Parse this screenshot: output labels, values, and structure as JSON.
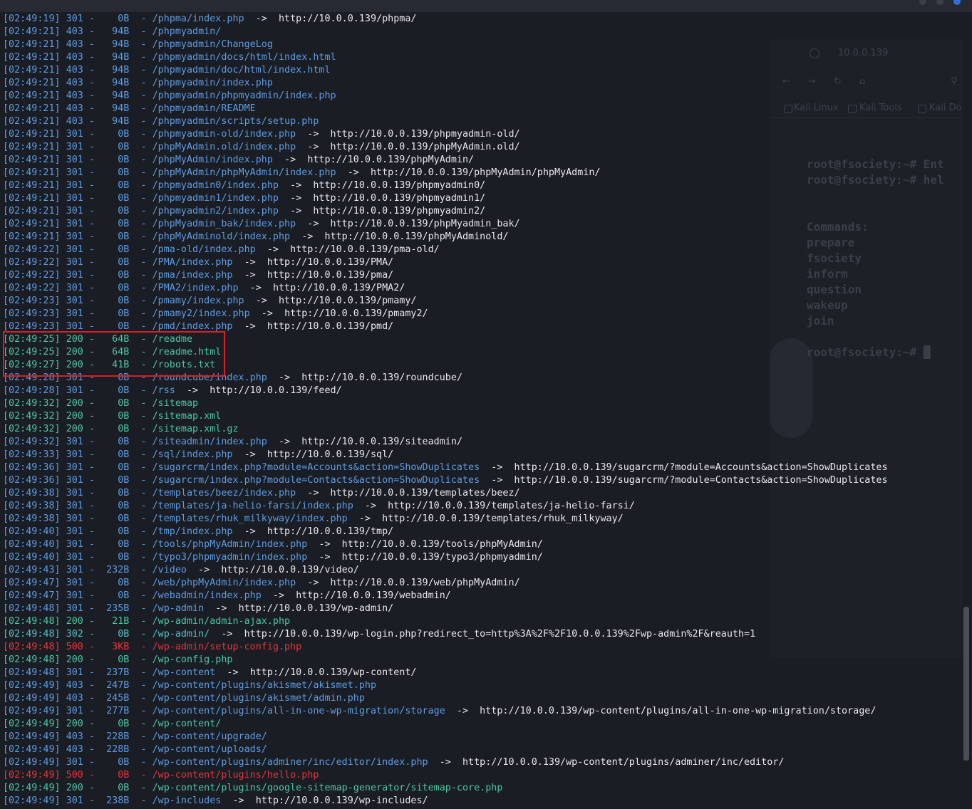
{
  "colors": {
    "status_200": "#4cc7a0",
    "status_301": "#5c9ce3",
    "status_302": "#54c1c8",
    "status_403": "#5c9ce3",
    "status_500": "#e5353d",
    "text": "#e6e8ec",
    "highlight_box": "#d61f26"
  },
  "background_window": {
    "tab_title": "10.0.0.139",
    "bookmarks": [
      "Kali Linux",
      "Kali Tools",
      "Kali Do"
    ],
    "terminal_lines": [
      "root@fsociety:~# Ent",
      "root@fsociety:~# hel",
      "",
      "",
      "Commands:",
      "prepare",
      "fsociety",
      "inform",
      "question",
      "wakeup",
      "join",
      "",
      "root@fsociety:~# █"
    ]
  },
  "scan_results": [
    {
      "time": "[02:49:19]",
      "status": "301",
      "size": "0B",
      "path": "/phpma/index.php",
      "redirect": "http://10.0.0.139/phpma/"
    },
    {
      "time": "[02:49:21]",
      "status": "403",
      "size": "94B",
      "path": "/phpmyadmin/",
      "redirect": ""
    },
    {
      "time": "[02:49:21]",
      "status": "403",
      "size": "94B",
      "path": "/phpmyadmin/ChangeLog",
      "redirect": ""
    },
    {
      "time": "[02:49:21]",
      "status": "403",
      "size": "94B",
      "path": "/phpmyadmin/docs/html/index.html",
      "redirect": ""
    },
    {
      "time": "[02:49:21]",
      "status": "403",
      "size": "94B",
      "path": "/phpmyadmin/doc/html/index.html",
      "redirect": ""
    },
    {
      "time": "[02:49:21]",
      "status": "403",
      "size": "94B",
      "path": "/phpmyadmin/index.php",
      "redirect": ""
    },
    {
      "time": "[02:49:21]",
      "status": "403",
      "size": "94B",
      "path": "/phpmyadmin/phpmyadmin/index.php",
      "redirect": ""
    },
    {
      "time": "[02:49:21]",
      "status": "403",
      "size": "94B",
      "path": "/phpmyadmin/README",
      "redirect": ""
    },
    {
      "time": "[02:49:21]",
      "status": "403",
      "size": "94B",
      "path": "/phpmyadmin/scripts/setup.php",
      "redirect": ""
    },
    {
      "time": "[02:49:21]",
      "status": "301",
      "size": "0B",
      "path": "/phpmyadmin-old/index.php",
      "redirect": "http://10.0.0.139/phpmyadmin-old/"
    },
    {
      "time": "[02:49:21]",
      "status": "301",
      "size": "0B",
      "path": "/phpMyAdmin.old/index.php",
      "redirect": "http://10.0.0.139/phpMyAdmin.old/"
    },
    {
      "time": "[02:49:21]",
      "status": "301",
      "size": "0B",
      "path": "/phpMyAdmin/index.php",
      "redirect": "http://10.0.0.139/phpMyAdmin/"
    },
    {
      "time": "[02:49:21]",
      "status": "301",
      "size": "0B",
      "path": "/phpMyAdmin/phpMyAdmin/index.php",
      "redirect": "http://10.0.0.139/phpMyAdmin/phpMyAdmin/"
    },
    {
      "time": "[02:49:21]",
      "status": "301",
      "size": "0B",
      "path": "/phpmyadmin0/index.php",
      "redirect": "http://10.0.0.139/phpmyadmin0/"
    },
    {
      "time": "[02:49:21]",
      "status": "301",
      "size": "0B",
      "path": "/phpmyadmin1/index.php",
      "redirect": "http://10.0.0.139/phpmyadmin1/"
    },
    {
      "time": "[02:49:21]",
      "status": "301",
      "size": "0B",
      "path": "/phpmyadmin2/index.php",
      "redirect": "http://10.0.0.139/phpmyadmin2/"
    },
    {
      "time": "[02:49:21]",
      "status": "301",
      "size": "0B",
      "path": "/phpMyadmin_bak/index.php",
      "redirect": "http://10.0.0.139/phpMyadmin_bak/"
    },
    {
      "time": "[02:49:21]",
      "status": "301",
      "size": "0B",
      "path": "/phpMyAdminold/index.php",
      "redirect": "http://10.0.0.139/phpMyAdminold/"
    },
    {
      "time": "[02:49:22]",
      "status": "301",
      "size": "0B",
      "path": "/pma-old/index.php",
      "redirect": "http://10.0.0.139/pma-old/"
    },
    {
      "time": "[02:49:22]",
      "status": "301",
      "size": "0B",
      "path": "/PMA/index.php",
      "redirect": "http://10.0.0.139/PMA/"
    },
    {
      "time": "[02:49:22]",
      "status": "301",
      "size": "0B",
      "path": "/pma/index.php",
      "redirect": "http://10.0.0.139/pma/"
    },
    {
      "time": "[02:49:22]",
      "status": "301",
      "size": "0B",
      "path": "/PMA2/index.php",
      "redirect": "http://10.0.0.139/PMA2/"
    },
    {
      "time": "[02:49:23]",
      "status": "301",
      "size": "0B",
      "path": "/pmamy/index.php",
      "redirect": "http://10.0.0.139/pmamy/"
    },
    {
      "time": "[02:49:23]",
      "status": "301",
      "size": "0B",
      "path": "/pmamy2/index.php",
      "redirect": "http://10.0.0.139/pmamy2/"
    },
    {
      "time": "[02:49:23]",
      "status": "301",
      "size": "0B",
      "path": "/pmd/index.php",
      "redirect": "http://10.0.0.139/pmd/"
    },
    {
      "time": "[02:49:25]",
      "status": "200",
      "size": "64B",
      "path": "/readme",
      "redirect": ""
    },
    {
      "time": "[02:49:25]",
      "status": "200",
      "size": "64B",
      "path": "/readme.html",
      "redirect": ""
    },
    {
      "time": "[02:49:27]",
      "status": "200",
      "size": "41B",
      "path": "/robots.txt",
      "redirect": ""
    },
    {
      "time": "[02:49:28]",
      "status": "301",
      "size": "0B",
      "path": "/roundcube/index.php",
      "redirect": "http://10.0.0.139/roundcube/"
    },
    {
      "time": "[02:49:28]",
      "status": "301",
      "size": "0B",
      "path": "/rss",
      "redirect": "http://10.0.0.139/feed/"
    },
    {
      "time": "[02:49:32]",
      "status": "200",
      "size": "0B",
      "path": "/sitemap",
      "redirect": ""
    },
    {
      "time": "[02:49:32]",
      "status": "200",
      "size": "0B",
      "path": "/sitemap.xml",
      "redirect": ""
    },
    {
      "time": "[02:49:32]",
      "status": "200",
      "size": "0B",
      "path": "/sitemap.xml.gz",
      "redirect": ""
    },
    {
      "time": "[02:49:32]",
      "status": "301",
      "size": "0B",
      "path": "/siteadmin/index.php",
      "redirect": "http://10.0.0.139/siteadmin/"
    },
    {
      "time": "[02:49:33]",
      "status": "301",
      "size": "0B",
      "path": "/sql/index.php",
      "redirect": "http://10.0.0.139/sql/"
    },
    {
      "time": "[02:49:36]",
      "status": "301",
      "size": "0B",
      "path": "/sugarcrm/index.php?module=Accounts&action=ShowDuplicates",
      "redirect": "http://10.0.0.139/sugarcrm/?module=Accounts&action=ShowDuplicates"
    },
    {
      "time": "[02:49:36]",
      "status": "301",
      "size": "0B",
      "path": "/sugarcrm/index.php?module=Contacts&action=ShowDuplicates",
      "redirect": "http://10.0.0.139/sugarcrm/?module=Contacts&action=ShowDuplicates"
    },
    {
      "time": "[02:49:38]",
      "status": "301",
      "size": "0B",
      "path": "/templates/beez/index.php",
      "redirect": "http://10.0.0.139/templates/beez/"
    },
    {
      "time": "[02:49:38]",
      "status": "301",
      "size": "0B",
      "path": "/templates/ja-helio-farsi/index.php",
      "redirect": "http://10.0.0.139/templates/ja-helio-farsi/"
    },
    {
      "time": "[02:49:38]",
      "status": "301",
      "size": "0B",
      "path": "/templates/rhuk_milkyway/index.php",
      "redirect": "http://10.0.0.139/templates/rhuk_milkyway/"
    },
    {
      "time": "[02:49:40]",
      "status": "301",
      "size": "0B",
      "path": "/tmp/index.php",
      "redirect": "http://10.0.0.139/tmp/"
    },
    {
      "time": "[02:49:40]",
      "status": "301",
      "size": "0B",
      "path": "/tools/phpMyAdmin/index.php",
      "redirect": "http://10.0.0.139/tools/phpMyAdmin/"
    },
    {
      "time": "[02:49:40]",
      "status": "301",
      "size": "0B",
      "path": "/typo3/phpmyadmin/index.php",
      "redirect": "http://10.0.0.139/typo3/phpmyadmin/"
    },
    {
      "time": "[02:49:43]",
      "status": "301",
      "size": "232B",
      "path": "/video",
      "redirect": "http://10.0.0.139/video/"
    },
    {
      "time": "[02:49:47]",
      "status": "301",
      "size": "0B",
      "path": "/web/phpMyAdmin/index.php",
      "redirect": "http://10.0.0.139/web/phpMyAdmin/"
    },
    {
      "time": "[02:49:47]",
      "status": "301",
      "size": "0B",
      "path": "/webadmin/index.php",
      "redirect": "http://10.0.0.139/webadmin/"
    },
    {
      "time": "[02:49:48]",
      "status": "301",
      "size": "235B",
      "path": "/wp-admin",
      "redirect": "http://10.0.0.139/wp-admin/"
    },
    {
      "time": "[02:49:48]",
      "status": "200",
      "size": "21B",
      "path": "/wp-admin/admin-ajax.php",
      "redirect": ""
    },
    {
      "time": "[02:49:48]",
      "status": "302",
      "size": "0B",
      "path": "/wp-admin/",
      "redirect": "http://10.0.0.139/wp-login.php?redirect_to=http%3A%2F%2F10.0.0.139%2Fwp-admin%2F&reauth=1"
    },
    {
      "time": "[02:49:48]",
      "status": "500",
      "size": "3KB",
      "path": "/wp-admin/setup-config.php",
      "redirect": ""
    },
    {
      "time": "[02:49:48]",
      "status": "200",
      "size": "0B",
      "path": "/wp-config.php",
      "redirect": ""
    },
    {
      "time": "[02:49:48]",
      "status": "301",
      "size": "237B",
      "path": "/wp-content",
      "redirect": "http://10.0.0.139/wp-content/"
    },
    {
      "time": "[02:49:49]",
      "status": "403",
      "size": "247B",
      "path": "/wp-content/plugins/akismet/akismet.php",
      "redirect": ""
    },
    {
      "time": "[02:49:49]",
      "status": "403",
      "size": "245B",
      "path": "/wp-content/plugins/akismet/admin.php",
      "redirect": ""
    },
    {
      "time": "[02:49:49]",
      "status": "301",
      "size": "277B",
      "path": "/wp-content/plugins/all-in-one-wp-migration/storage",
      "redirect": "http://10.0.0.139/wp-content/plugins/all-in-one-wp-migration/storage/"
    },
    {
      "time": "[02:49:49]",
      "status": "200",
      "size": "0B",
      "path": "/wp-content/",
      "redirect": ""
    },
    {
      "time": "[02:49:49]",
      "status": "403",
      "size": "228B",
      "path": "/wp-content/upgrade/",
      "redirect": ""
    },
    {
      "time": "[02:49:49]",
      "status": "403",
      "size": "228B",
      "path": "/wp-content/uploads/",
      "redirect": ""
    },
    {
      "time": "[02:49:49]",
      "status": "301",
      "size": "0B",
      "path": "/wp-content/plugins/adminer/inc/editor/index.php",
      "redirect": "http://10.0.0.139/wp-content/plugins/adminer/inc/editor/"
    },
    {
      "time": "[02:49:49]",
      "status": "500",
      "size": "0B",
      "path": "/wp-content/plugins/hello.php",
      "redirect": ""
    },
    {
      "time": "[02:49:49]",
      "status": "200",
      "size": "0B",
      "path": "/wp-content/plugins/google-sitemap-generator/sitemap-core.php",
      "redirect": ""
    },
    {
      "time": "[02:49:49]",
      "status": "301",
      "size": "238B",
      "path": "/wp-includes",
      "redirect": "http://10.0.0.139/wp-includes/"
    }
  ]
}
